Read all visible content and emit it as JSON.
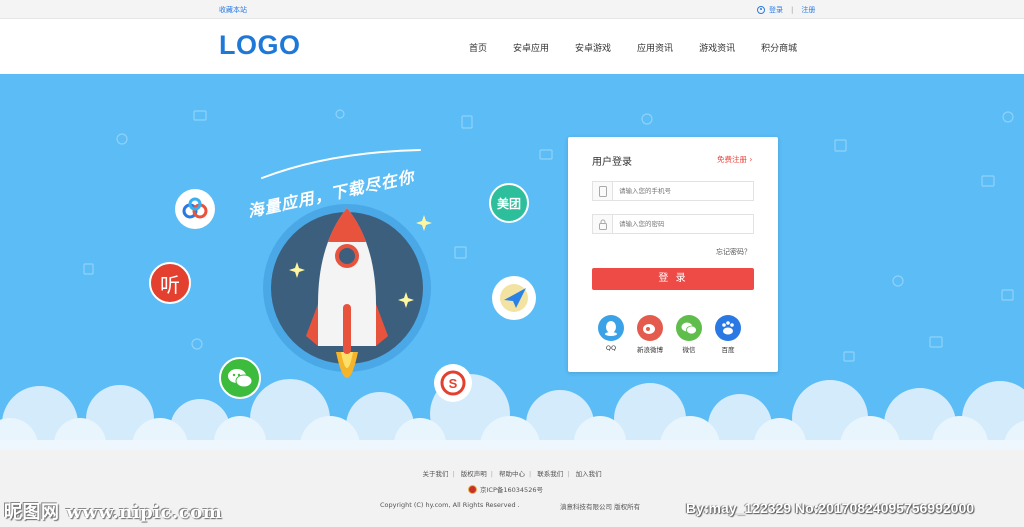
{
  "topbar": {
    "bookmark": "收藏本站",
    "login": "登录",
    "register": "注册"
  },
  "header": {
    "logo": "LOGO",
    "nav": [
      "首页",
      "安卓应用",
      "安卓游戏",
      "应用资讯",
      "游戏资讯",
      "积分商城"
    ]
  },
  "hero": {
    "slogan": "海量应用，下载尽在你"
  },
  "apps": {
    "meituan": "美团",
    "ting": "听"
  },
  "login": {
    "title": "用户登录",
    "register_link": "免费注册 ›",
    "phone_placeholder": "请输入您的手机号",
    "password_placeholder": "请输入您的密码",
    "forgot": "忘记密码？",
    "submit": "登 录",
    "social": [
      {
        "label": "QQ",
        "icon": "qq-icon"
      },
      {
        "label": "新浪微博",
        "icon": "weibo-icon"
      },
      {
        "label": "微信",
        "icon": "wechat-icon"
      },
      {
        "label": "百度",
        "icon": "baidu-icon"
      }
    ]
  },
  "footer": {
    "links": [
      "关于我们",
      "版权声明",
      "帮助中心",
      "联系我们",
      "加入我们"
    ],
    "icp": "京ICP备16034526号",
    "copyright": "Copyright (C) hy.com, All Rights Reserved .",
    "company": "滇意科技有限公司 版权所有"
  },
  "watermark": {
    "left": "昵图网 www.nipic.com",
    "right": "By:may_122329 No:20170824095756992000"
  },
  "colors": {
    "sky": "#5bbcf6",
    "accent": "#ee4a46",
    "logo": "#1e78d8"
  }
}
